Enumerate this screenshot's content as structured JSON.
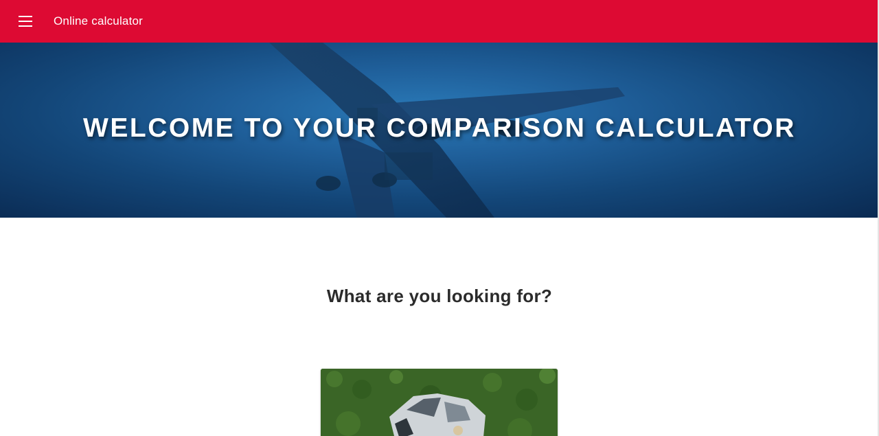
{
  "topbar": {
    "title": "Online calculator",
    "background": "#dd0a33",
    "menu_icon": "menu-icon"
  },
  "hero": {
    "title": "WELCOME TO YOUR COMPARISON CALCULATOR",
    "image": "airplane-underside-image"
  },
  "main": {
    "question": "What are you looking for?",
    "cards": [
      {
        "image": "wrecked-car-image"
      }
    ]
  }
}
